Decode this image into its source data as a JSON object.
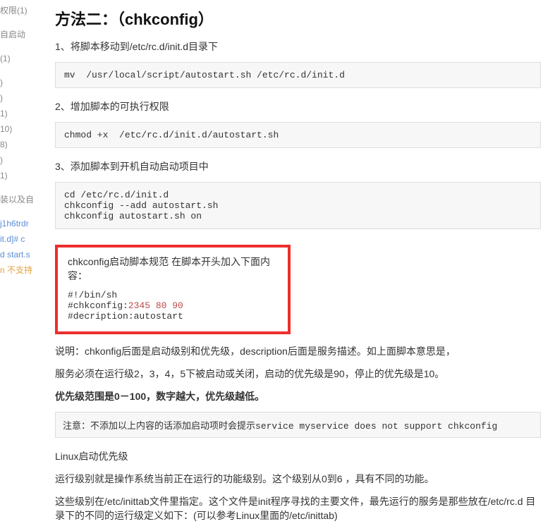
{
  "sidebar": {
    "l1": "权限(1)",
    "l2": "自启动",
    "l3": "(1)",
    "c1": ")",
    "c2": ")",
    "c3": "1)",
    "c4": "10)",
    "c5": "8)",
    "c6": ")",
    "c7": "1)",
    "p1": "装以及自",
    "b1": "j1h6trdr",
    "b2": "it.d]# c",
    "b3": "d start.s",
    "b4": "n 不支持"
  },
  "title": "方法二：（chkconfig）",
  "step1": "1、将脚本移动到/etc/rc.d/init.d目录下",
  "code1": "mv  /usr/local/script/autostart.sh /etc/rc.d/init.d",
  "step2": "2、增加脚本的可执行权限",
  "code2": "chmod +x  /etc/rc.d/init.d/autostart.sh",
  "step3": "3、添加脚本到开机自动启动项目中",
  "code3": "cd /etc/rc.d/init.d\nchkconfig --add autostart.sh\nchkconfig autostart.sh on",
  "redbox": {
    "header": "chkconfig启动脚本规范 在脚本开头加入下面内容：",
    "line1": "#!/bin/sh",
    "line2_a": "#chkconfig:",
    "line2_b": "2345 80 90",
    "line3": "#decription:autostart"
  },
  "explain1": "说明：chkonfig后面是启动级别和优先级，description后面是服务描述。如上面脚本意思是，",
  "explain2": "服务必须在运行级2，3，4，5下被启动或关闭，启动的优先级是90，停止的优先级是10。",
  "boldline": "优先级范围是0－100，数字越大，优先级越低。",
  "note_prefix": "注意：不添加以上内容的话添加启动项时会提示",
  "note_mono": "service myservice does not support chkconfig",
  "linux_h": "Linux启动优先级",
  "linux_p1": "运行级别就是操作系统当前正在运行的功能级别。这个级别从0到6 ，具有不同的功能。",
  "linux_p2": "这些级别在/etc/inittab文件里指定。这个文件是init程序寻找的主要文件，最先运行的服务是那些放在/etc/rc.d 目录下的不同的运行级定义如下：(可以参考Linux里面的/etc/inittab)"
}
